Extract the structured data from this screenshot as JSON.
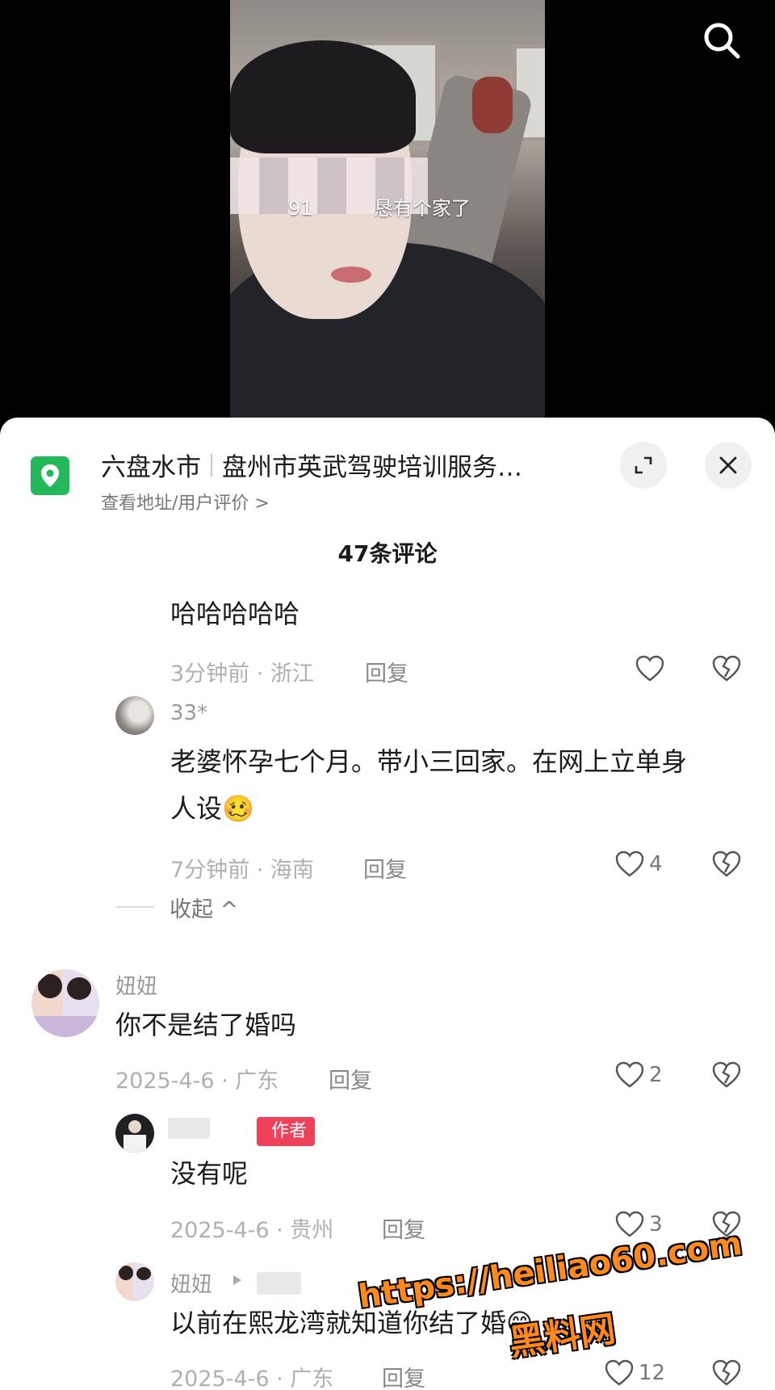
{
  "video": {
    "caption_prefix": "91",
    "caption_suffix": "恳有个家了"
  },
  "location": {
    "city": "六盘水市",
    "place": "盘州市英武驾驶培训服务…",
    "subtitle": "查看地址/用户评价 >"
  },
  "comments_header": "47条评论",
  "comments": [
    {
      "text": "哈哈哈哈哈",
      "meta": "3分钟前 · 浙江",
      "reply": "回复",
      "likes": ""
    },
    {
      "user": "33*",
      "text_line1": "老婆怀孕七个月。带小三回家。在网上立单身",
      "text_line2": "人设🥴",
      "meta": "7分钟前 · 海南",
      "reply": "回复",
      "likes": "4"
    },
    {
      "user": "妞妞",
      "text": "你不是结了婚吗",
      "meta": "2025-4-6 · 广东",
      "reply": "回复",
      "likes": "2"
    },
    {
      "author_tag": "作者",
      "text": "没有呢",
      "meta": "2025-4-6 · 贵州",
      "reply": "回复",
      "likes": "3"
    },
    {
      "user": "妞妞",
      "text": "以前在熙龙湾就知道你结了婚😁",
      "meta": "2025-4-6 · 广东",
      "reply": "回复",
      "likes": "12"
    }
  ],
  "collapse_label": "收起 ^",
  "watermark": {
    "url": "https://heiliao60.com",
    "name": "黑料网"
  },
  "colors": {
    "pin": "#23b85a",
    "author_tag": "#f0415a",
    "watermark": "#ff8a1a"
  }
}
